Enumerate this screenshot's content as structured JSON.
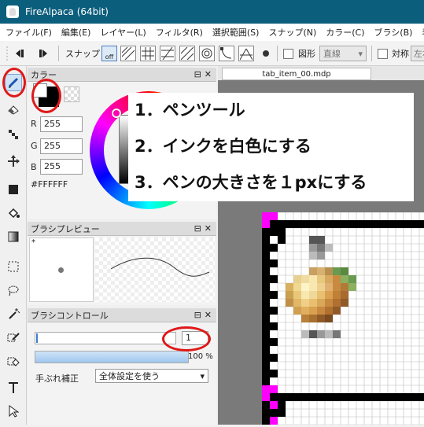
{
  "window": {
    "title": "FireAlpaca (64bit)"
  },
  "menu": [
    "ファイル(F)",
    "編集(E)",
    "レイヤー(L)",
    "フィルタ(R)",
    "選択範囲(S)",
    "スナップ(N)",
    "カラー(C)",
    "ブラシ(B)",
    "表示"
  ],
  "toolbar": {
    "snap_label": "スナップ",
    "snap_off_label": "off",
    "shape_label": "図形",
    "shape_select_value": "直線",
    "symmetry_label": "対称",
    "symmetry_select_value": "左右"
  },
  "color_panel": {
    "title": "カラー",
    "r_label": "R",
    "r_value": "255",
    "g_label": "G",
    "g_value": "255",
    "b_label": "B",
    "b_value": "255",
    "hex": "#FFFFFF",
    "fg_color": "#ffffff",
    "bg_color": "#000000"
  },
  "brush_preview_panel": {
    "title": "ブラシプレビュー",
    "marker": "*"
  },
  "brush_control_panel": {
    "title": "ブラシコントロール",
    "size_value": "1",
    "opacity_label": "100 %",
    "opacity_fraction": 1.0,
    "stabilizer_label": "手ぶれ補正",
    "stabilizer_value": "全体設定を使う"
  },
  "document": {
    "tab_name": "tab_item_00.mdp"
  },
  "callout": {
    "line1": "1．ペンツール",
    "line2": "2．インクを白色にする",
    "line3": "3．ペンの大きさを１pxにする"
  },
  "colors": {
    "titlebar": "#0b5e7c",
    "highlight_ring": "#e01818",
    "canvas_bg": "#7a7a7a"
  }
}
